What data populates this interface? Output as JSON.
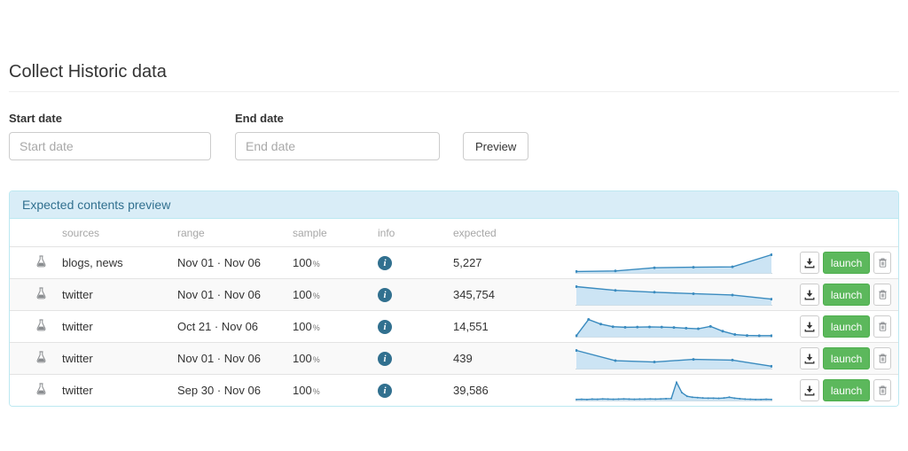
{
  "page": {
    "title": "Collect Historic data"
  },
  "form": {
    "start_date": {
      "label": "Start date",
      "placeholder": "Start date",
      "value": ""
    },
    "end_date": {
      "label": "End date",
      "placeholder": "End date",
      "value": ""
    },
    "preview_button": "Preview"
  },
  "panel": {
    "title": "Expected contents preview",
    "columns": {
      "sources": "sources",
      "range": "range",
      "sample": "sample",
      "info": "info",
      "expected": "expected"
    },
    "actions": {
      "launch": "launch"
    },
    "rows": [
      {
        "sources": "blogs, news",
        "range": "Nov 01 · Nov 06",
        "sample": "100",
        "sample_pct": "%",
        "info_icon": "info-circle",
        "expected": "5,227",
        "sparkline": [
          0.1,
          0.13,
          0.3,
          0.33,
          0.35,
          1.0
        ]
      },
      {
        "sources": "twitter",
        "range": "Nov 01 · Nov 06",
        "sample": "100",
        "sample_pct": "%",
        "info_icon": "info-circle",
        "expected": "345,754",
        "sparkline": [
          1.0,
          0.8,
          0.7,
          0.62,
          0.55,
          0.33
        ]
      },
      {
        "sources": "twitter",
        "range": "Oct 21 · Nov 06",
        "sample": "100",
        "sample_pct": "%",
        "info_icon": "info-circle",
        "expected": "14,551",
        "sparkline": [
          0.08,
          0.95,
          0.7,
          0.56,
          0.53,
          0.54,
          0.55,
          0.54,
          0.52,
          0.48,
          0.45,
          0.58,
          0.32,
          0.14,
          0.09,
          0.08,
          0.08
        ]
      },
      {
        "sources": "twitter",
        "range": "Nov 01 · Nov 06",
        "sample": "100",
        "sample_pct": "%",
        "info_icon": "info-circle",
        "expected": "439",
        "sparkline": [
          1.0,
          0.45,
          0.38,
          0.52,
          0.48,
          0.15
        ]
      },
      {
        "sources": "twitter",
        "range": "Sep 30 · Nov 06",
        "sample": "100",
        "sample_pct": "%",
        "info_icon": "info-circle",
        "expected": "39,586",
        "sparkline": [
          0.08,
          0.09,
          0.08,
          0.1,
          0.09,
          0.11,
          0.1,
          0.09,
          0.1,
          0.11,
          0.1,
          0.09,
          0.1,
          0.1,
          0.11,
          0.1,
          0.11,
          0.12,
          0.13,
          1.0,
          0.45,
          0.25,
          0.2,
          0.18,
          0.16,
          0.15,
          0.15,
          0.14,
          0.16,
          0.2,
          0.15,
          0.12,
          0.1,
          0.09,
          0.08,
          0.08,
          0.09,
          0.08
        ]
      }
    ]
  },
  "colors": {
    "panel_header_bg": "#d9edf7",
    "panel_border": "#bce8f1",
    "panel_title_text": "#31708f",
    "info_icon": "#31708f",
    "launch_green": "#5cb85c",
    "spark_line": "#3a8bbf",
    "spark_fill": "#cce4f4"
  }
}
